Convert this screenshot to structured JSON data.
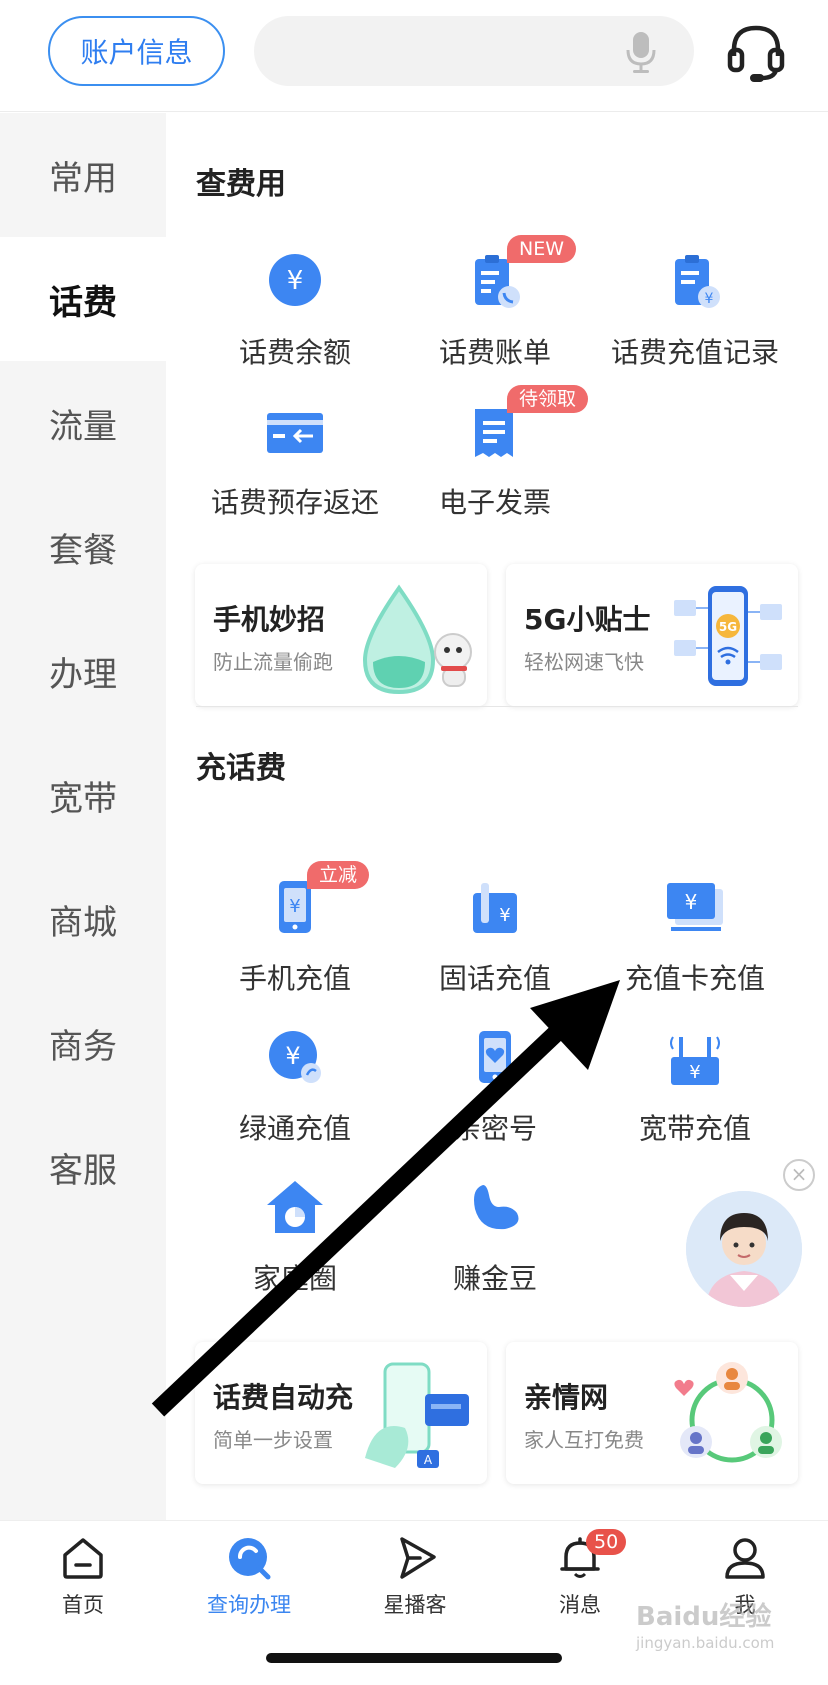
{
  "header": {
    "account_label": "账户信息",
    "mic_icon": "microphone-icon",
    "service_icon": "headset-icon"
  },
  "sidebar": {
    "items": [
      {
        "label": "常用"
      },
      {
        "label": "话费",
        "active": true
      },
      {
        "label": "流量"
      },
      {
        "label": "套餐"
      },
      {
        "label": "办理"
      },
      {
        "label": "宽带"
      },
      {
        "label": "商城"
      },
      {
        "label": "商务"
      },
      {
        "label": "客服"
      }
    ]
  },
  "sections": {
    "query": {
      "title": "查费用",
      "items": [
        {
          "label": "话费余额",
          "icon": "yuan-coin-icon"
        },
        {
          "label": "话费账单",
          "icon": "bill-phone-icon",
          "badge": "NEW"
        },
        {
          "label": "话费充值记录",
          "icon": "recharge-record-icon"
        },
        {
          "label": "话费预存返还",
          "icon": "card-return-icon"
        },
        {
          "label": "电子发票",
          "icon": "invoice-icon",
          "badge": "待领取"
        }
      ],
      "cards": [
        {
          "title": "手机妙招",
          "subtitle": "防止流量偷跑",
          "image": "water-drop-mascot"
        },
        {
          "title": "5G小贴士",
          "subtitle": "轻松网速飞快",
          "image": "5g-phone"
        }
      ]
    },
    "recharge": {
      "title": "充话费",
      "items": [
        {
          "label": "手机充值",
          "icon": "phone-recharge-icon",
          "badge": "立减"
        },
        {
          "label": "固话充值",
          "icon": "landline-recharge-icon"
        },
        {
          "label": "充值卡充值",
          "icon": "recharge-card-icon"
        },
        {
          "label": "绿通充值",
          "icon": "green-recharge-icon"
        },
        {
          "label": "亲密号",
          "icon": "heart-phone-icon"
        },
        {
          "label": "宽带充值",
          "icon": "router-recharge-icon"
        },
        {
          "label": "家庭圈",
          "icon": "home-circle-icon"
        },
        {
          "label": "赚金豆",
          "icon": "bean-icon"
        }
      ],
      "cards": [
        {
          "title": "话费自动充",
          "subtitle": "简单一步设置",
          "image": "auto-recharge-phone"
        },
        {
          "title": "亲情网",
          "subtitle": "家人互打免费",
          "image": "family-network"
        }
      ]
    }
  },
  "bottom_nav": {
    "items": [
      {
        "label": "首页",
        "icon": "home-icon"
      },
      {
        "label": "查询办理",
        "icon": "search-handle-icon",
        "active": true
      },
      {
        "label": "星播客",
        "icon": "play-icon"
      },
      {
        "label": "消息",
        "icon": "bell-icon",
        "badge": "50"
      },
      {
        "label": "我",
        "icon": "user-icon"
      }
    ]
  },
  "watermark": {
    "text": "Baidu经验",
    "sub": "jingyan.baidu.com"
  },
  "colors": {
    "accent": "#3b86f0",
    "badge": "#f06b6b",
    "sidebar_bg": "#f5f5f5"
  }
}
